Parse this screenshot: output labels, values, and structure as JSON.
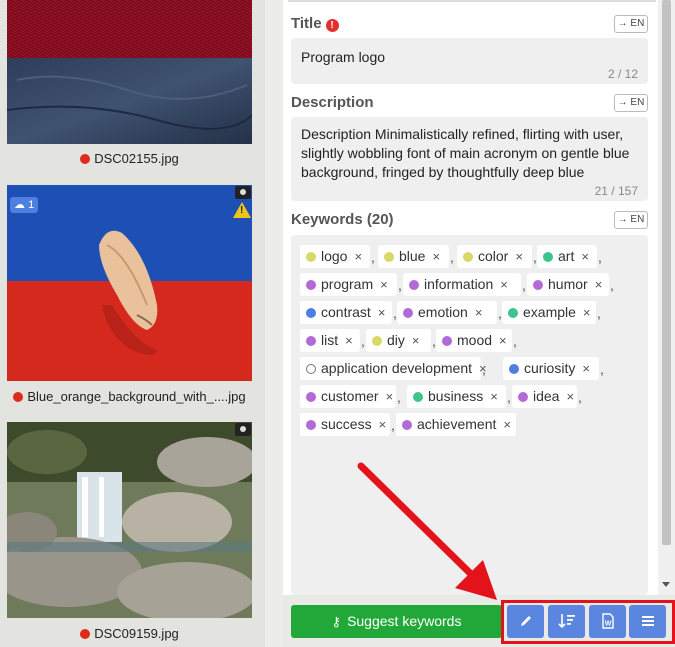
{
  "thumbnails": [
    {
      "filename": "DSC02155.jpg"
    },
    {
      "filename": "Blue_orange_background_with_....jpg",
      "upload_count": "1"
    },
    {
      "filename": "DSC09159.jpg"
    }
  ],
  "title_section": {
    "heading": "Title",
    "required_mark": "!",
    "lang_button": "→ EN",
    "value": "Program logo",
    "counter": "2 / 12"
  },
  "description_section": {
    "heading": "Description",
    "lang_button": "→ EN",
    "value": "Description Minimalistically refined, flirting with user, slightly wobbling font of main acronym on gentle blue background, fringed by thoughtfully deep blue",
    "counter": "21 / 157"
  },
  "keywords_section": {
    "heading": "Keywords (20)",
    "lang_button": "→ EN",
    "remove_glyph": "×",
    "keywords": [
      {
        "text": "logo",
        "color": "#d9d96a"
      },
      {
        "text": "blue",
        "color": "#d9d96a"
      },
      {
        "text": "color",
        "color": "#d9d96a"
      },
      {
        "text": "art",
        "color": "#3dc48c"
      },
      {
        "text": "program",
        "color": "#b36ad9"
      },
      {
        "text": "information",
        "color": "#b36ad9"
      },
      {
        "text": "humor",
        "color": "#b36ad9"
      },
      {
        "text": "contrast",
        "color": "#4f7fe0"
      },
      {
        "text": "emotion",
        "color": "#b36ad9"
      },
      {
        "text": "example",
        "color": "#3dc48c"
      },
      {
        "text": "list",
        "color": "#b36ad9"
      },
      {
        "text": "diy",
        "color": "#d9d96a"
      },
      {
        "text": "mood",
        "color": "#b36ad9"
      },
      {
        "text": "application development",
        "color": "#ffffff"
      },
      {
        "text": "curiosity",
        "color": "#4f7fe0"
      },
      {
        "text": "customer",
        "color": "#b36ad9"
      },
      {
        "text": "business",
        "color": "#3dc48c"
      },
      {
        "text": "idea",
        "color": "#b36ad9"
      },
      {
        "text": "success",
        "color": "#b36ad9"
      },
      {
        "text": "achievement",
        "color": "#b36ad9"
      }
    ]
  },
  "actions": {
    "suggest_label": "Suggest keywords",
    "buttons": [
      {
        "icon": "pencil-icon"
      },
      {
        "icon": "sort-icon"
      },
      {
        "icon": "word-doc-icon"
      },
      {
        "icon": "menu-icon"
      }
    ]
  },
  "colors": {
    "accent_green": "#22a838",
    "accent_blue": "#5a86df",
    "highlight_red": "#e3121b",
    "status_red": "#e02a1a"
  }
}
